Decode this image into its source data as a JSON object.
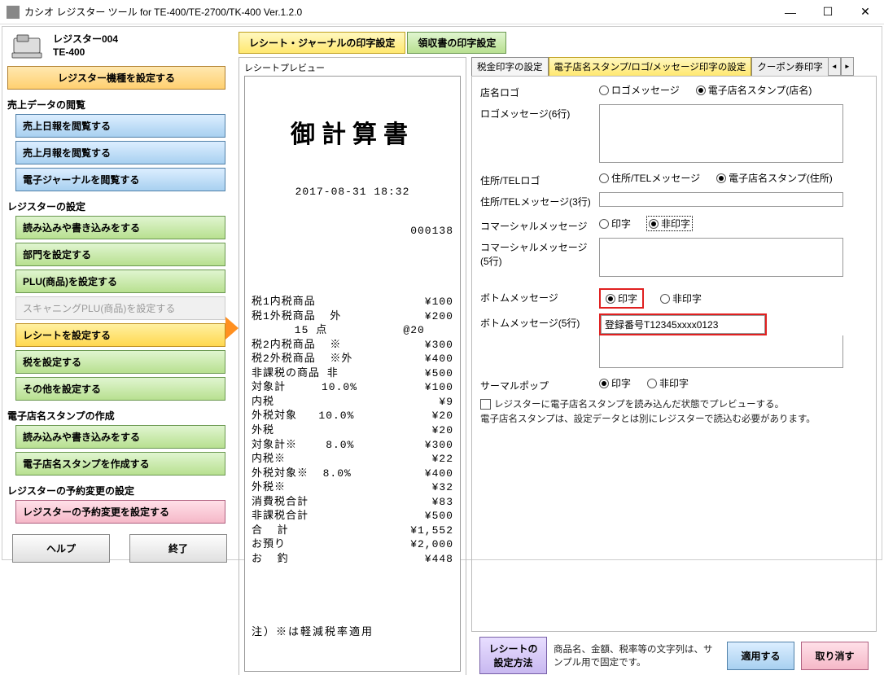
{
  "window": {
    "title": "カシオ レジスター ツール for TE-400/TE-2700/TK-400 Ver.1.2.0"
  },
  "register": {
    "name": "レジスター004",
    "model": "TE-400",
    "set_model_btn": "レジスター機種を設定する"
  },
  "sections": {
    "sales": {
      "title": "売上データの閲覧",
      "daily": "売上日報を閲覧する",
      "monthly": "売上月報を閲覧する",
      "ejournal": "電子ジャーナルを閲覧する"
    },
    "settings": {
      "title": "レジスターの設定",
      "rw": "読み込みや書き込みをする",
      "dept": "部門を設定する",
      "plu": "PLU(商品)を設定する",
      "scan": "スキャニングPLU(商品)を設定する",
      "receipt": "レシートを設定する",
      "tax": "税を設定する",
      "other": "その他を設定する"
    },
    "stamp": {
      "title": "電子店名スタンプの作成",
      "rw": "読み込みや書き込みをする",
      "create": "電子店名スタンプを作成する"
    },
    "reserve": {
      "title": "レジスターの予約変更の設定",
      "set": "レジスターの予約変更を設定する"
    }
  },
  "bottom": {
    "help": "ヘルプ",
    "exit": "終了"
  },
  "toptabs": {
    "receipt_journal": "レシート・ジャーナルの印字設定",
    "ryoshu": "領収書の印字設定"
  },
  "preview": {
    "label": "レシートプレビュー",
    "header": "御計算書",
    "datetime": "2017-08-31 18:32",
    "number": "000138",
    "lines": [
      {
        "l": "税1内税商品",
        "r": "¥100"
      },
      {
        "l": "税1外税商品  外",
        "r": "¥200"
      },
      {
        "l": "      15 点",
        "r": "@20    "
      },
      {
        "l": "税2内税商品  ※",
        "r": "¥300"
      },
      {
        "l": "税2外税商品  ※外",
        "r": "¥400"
      },
      {
        "l": "非課税の商品 非",
        "r": "¥500"
      },
      {
        "l": "対象計     10.0%",
        "r": "¥100"
      },
      {
        "l": "内税",
        "r": "¥9"
      },
      {
        "l": "外税対象   10.0%",
        "r": "¥20"
      },
      {
        "l": "外税",
        "r": "¥20"
      },
      {
        "l": "対象計※    8.0%",
        "r": "¥300"
      },
      {
        "l": "内税※",
        "r": "¥22"
      },
      {
        "l": "外税対象※  8.0%",
        "r": "¥400"
      },
      {
        "l": "外税※",
        "r": "¥32"
      },
      {
        "l": "消費税合計",
        "r": "¥83"
      },
      {
        "l": "非課税合計",
        "r": "¥500"
      },
      {
        "l": "合  計",
        "r": "¥1,552"
      },
      {
        "l": "お預り",
        "r": "¥2,000"
      },
      {
        "l": "お  釣",
        "r": "¥448"
      }
    ],
    "note": "注）※は軽減税率適用"
  },
  "subtabs": {
    "t1": "税金印字の設定",
    "t2": "電子店名スタンプ/ロゴ/メッセージ印字の設定",
    "t3": "クーポン券印字"
  },
  "form": {
    "shop_logo": "店名ロゴ",
    "opt_logo_msg": "ロゴメッセージ",
    "opt_stamp_name": "電子店名スタンプ(店名)",
    "logo_msg_label": "ロゴメッセージ(6行)",
    "addr_logo": "住所/TELロゴ",
    "opt_addr_msg": "住所/TELメッセージ",
    "opt_stamp_addr": "電子店名スタンプ(住所)",
    "addr_msg_label": "住所/TELメッセージ(3行)",
    "commercial": "コマーシャルメッセージ",
    "opt_print": "印字",
    "opt_noprint": "非印字",
    "commercial_label": "コマーシャルメッセージ(5行)",
    "bottom_msg": "ボトムメッセージ",
    "bottom_msg_label": "ボトムメッセージ(5行)",
    "bottom_msg_text": "登録番号T12345xxxx0123",
    "thermal": "サーマルポップ",
    "preview_check": "レジスターに電子店名スタンプを読み込んだ状態でプレビューする。",
    "preview_note": "電子店名スタンプは、設定データとは別にレジスターで読込む必要があります。"
  },
  "footer": {
    "howto": "レシートの設定方法",
    "note": "商品名、金額、税率等の文字列は、サンプル用で固定です。",
    "apply": "適用する",
    "cancel": "取り消す"
  }
}
